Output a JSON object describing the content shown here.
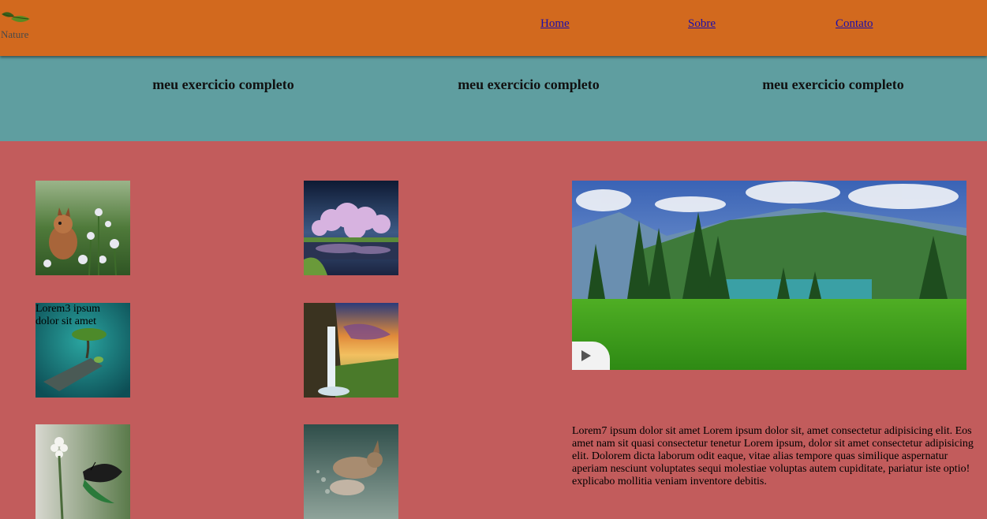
{
  "header": {
    "logo_text": "Nature",
    "nav": [
      {
        "label": "Home"
      },
      {
        "label": "Sobre"
      },
      {
        "label": "Contato"
      }
    ]
  },
  "banner": {
    "headings": [
      "meu exercicio completo",
      "meu exercicio completo",
      "meu exercicio completo"
    ]
  },
  "gallery": {
    "caption": "Lorem3 ipsum dolor sit amet"
  },
  "article": {
    "text": "Lorem7 ipsum dolor sit amet Lorem ipsum dolor sit, amet consectetur adipisicing elit. Eos amet nam sit quasi consectetur tenetur Lorem ipsum, dolor sit amet consectetur adipisicing elit. Dolorem dicta laborum odit eaque, vitae alias tempore quas similique aspernatur aperiam nesciunt voluptates sequi molestiae voluptas autem cupiditate, pariatur iste optio! explicabo mollitia veniam inventore debitis."
  },
  "colors": {
    "header_bg": "#d2691e",
    "banner_bg": "#5f9ea0",
    "body_bg": "#c25c5c",
    "link": "#1a0dab"
  },
  "icons": {
    "logo": "leaf-icon",
    "video_control": "play-icon"
  }
}
